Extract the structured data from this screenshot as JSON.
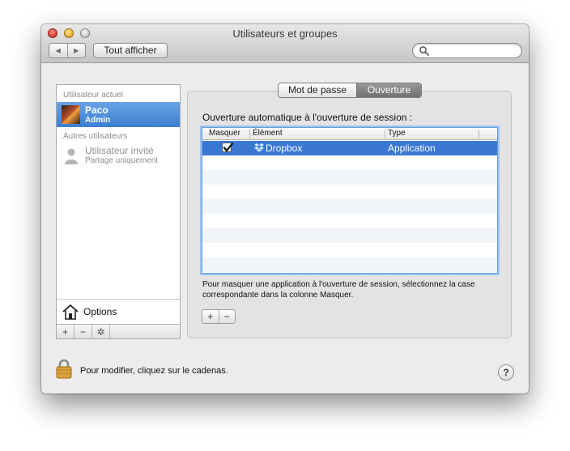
{
  "window": {
    "title": "Utilisateurs et groupes"
  },
  "toolbar": {
    "back_glyph": "◀",
    "forward_glyph": "▶",
    "show_all_label": "Tout afficher",
    "search_placeholder": ""
  },
  "sidebar": {
    "current_header": "Utilisateur actuel",
    "current_user": {
      "name": "Paco",
      "role": "Admin"
    },
    "others_header": "Autres utilisateurs",
    "guest": {
      "name": "Utilisateur invité",
      "subtitle": "Partage uniquement"
    },
    "options_label": "Options",
    "bar": {
      "add": "+",
      "remove": "−",
      "gear": "✲"
    }
  },
  "tabs": [
    {
      "label": "Mot de passe",
      "selected": false
    },
    {
      "label": "Ouverture",
      "selected": true
    }
  ],
  "login_items": {
    "heading": "Ouverture automatique à l'ouverture de session :",
    "columns": [
      "Masquer",
      "Élément",
      "Type"
    ],
    "rows": [
      {
        "hide": true,
        "item": "Dropbox",
        "type": "Application",
        "selected": true
      }
    ],
    "hint": "Pour masquer une application à l'ouverture de session, sélectionnez la case correspondante dans la colonne Masquer.",
    "add_label": "+",
    "remove_label": "−"
  },
  "footer": {
    "lock_text": "Pour modifier, cliquez sur le cadenas.",
    "help_label": "?"
  },
  "colors": {
    "selection": "#3a78d4",
    "sidebar_selection": "#4a8ada",
    "window_bg": "#ececec"
  },
  "icons": {
    "close": "close-button-icon",
    "minimize": "minimize-button-icon",
    "zoom": "zoom-button-icon",
    "search": "search-icon",
    "guest": "person-icon",
    "options": "house-icon",
    "dropbox": "dropbox-icon",
    "lock": "lock-icon"
  }
}
